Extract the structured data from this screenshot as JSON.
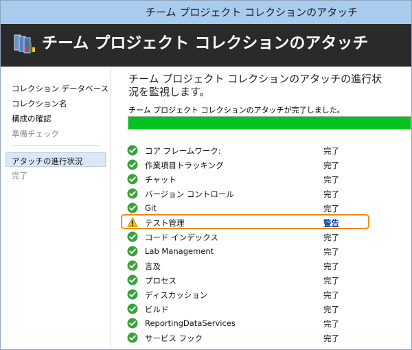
{
  "window": {
    "title": "チーム プロジェクト コレクションのアタッチ"
  },
  "header": {
    "title": "チーム プロジェクト コレクションのアタッチ",
    "icon": "server-icon"
  },
  "sidebar": {
    "items": [
      {
        "label": "コレクション データベース",
        "state": "done"
      },
      {
        "label": "コレクション名",
        "state": "done"
      },
      {
        "label": "構成の確認",
        "state": "done"
      },
      {
        "label": "準備チェック",
        "state": "disabled"
      },
      {
        "label": "アタッチの進行状況",
        "state": "selected"
      },
      {
        "label": "完了",
        "state": "disabled"
      }
    ]
  },
  "main": {
    "heading": "チーム プロジェクト コレクションのアタッチの進行状況を監視します。",
    "status_message": "チーム プロジェクト コレクションのアタッチが完了しました。",
    "progress_percent": 100,
    "progress_color": "#06c220",
    "tasks": [
      {
        "name": "コア フレームワーク:",
        "status": "完了",
        "icon": "check-icon"
      },
      {
        "name": "作業項目トラッキング",
        "status": "完了",
        "icon": "check-icon"
      },
      {
        "name": "チャット",
        "status": "完了",
        "icon": "check-icon"
      },
      {
        "name": "バージョン コントロール",
        "status": "完了",
        "icon": "check-icon"
      },
      {
        "name": "Git",
        "status": "完了",
        "icon": "check-icon"
      },
      {
        "name": "テスト管理",
        "status": "警告",
        "icon": "warning-icon"
      },
      {
        "name": "コード インデックス",
        "status": "完了",
        "icon": "check-icon"
      },
      {
        "name": "Lab Management",
        "status": "完了",
        "icon": "check-icon"
      },
      {
        "name": "言及",
        "status": "完了",
        "icon": "check-icon"
      },
      {
        "name": "プロセス",
        "status": "完了",
        "icon": "check-icon"
      },
      {
        "name": "ディスカッション",
        "status": "完了",
        "icon": "check-icon"
      },
      {
        "name": "ビルド",
        "status": "完了",
        "icon": "check-icon"
      },
      {
        "name": "ReportingDataServices",
        "status": "完了",
        "icon": "check-icon"
      },
      {
        "name": "サービス フック",
        "status": "完了",
        "icon": "check-icon"
      }
    ]
  },
  "colors": {
    "success": "#39a23a",
    "warning": "#f2c200",
    "highlight": "#f08a12",
    "link": "#1a4fb0"
  }
}
